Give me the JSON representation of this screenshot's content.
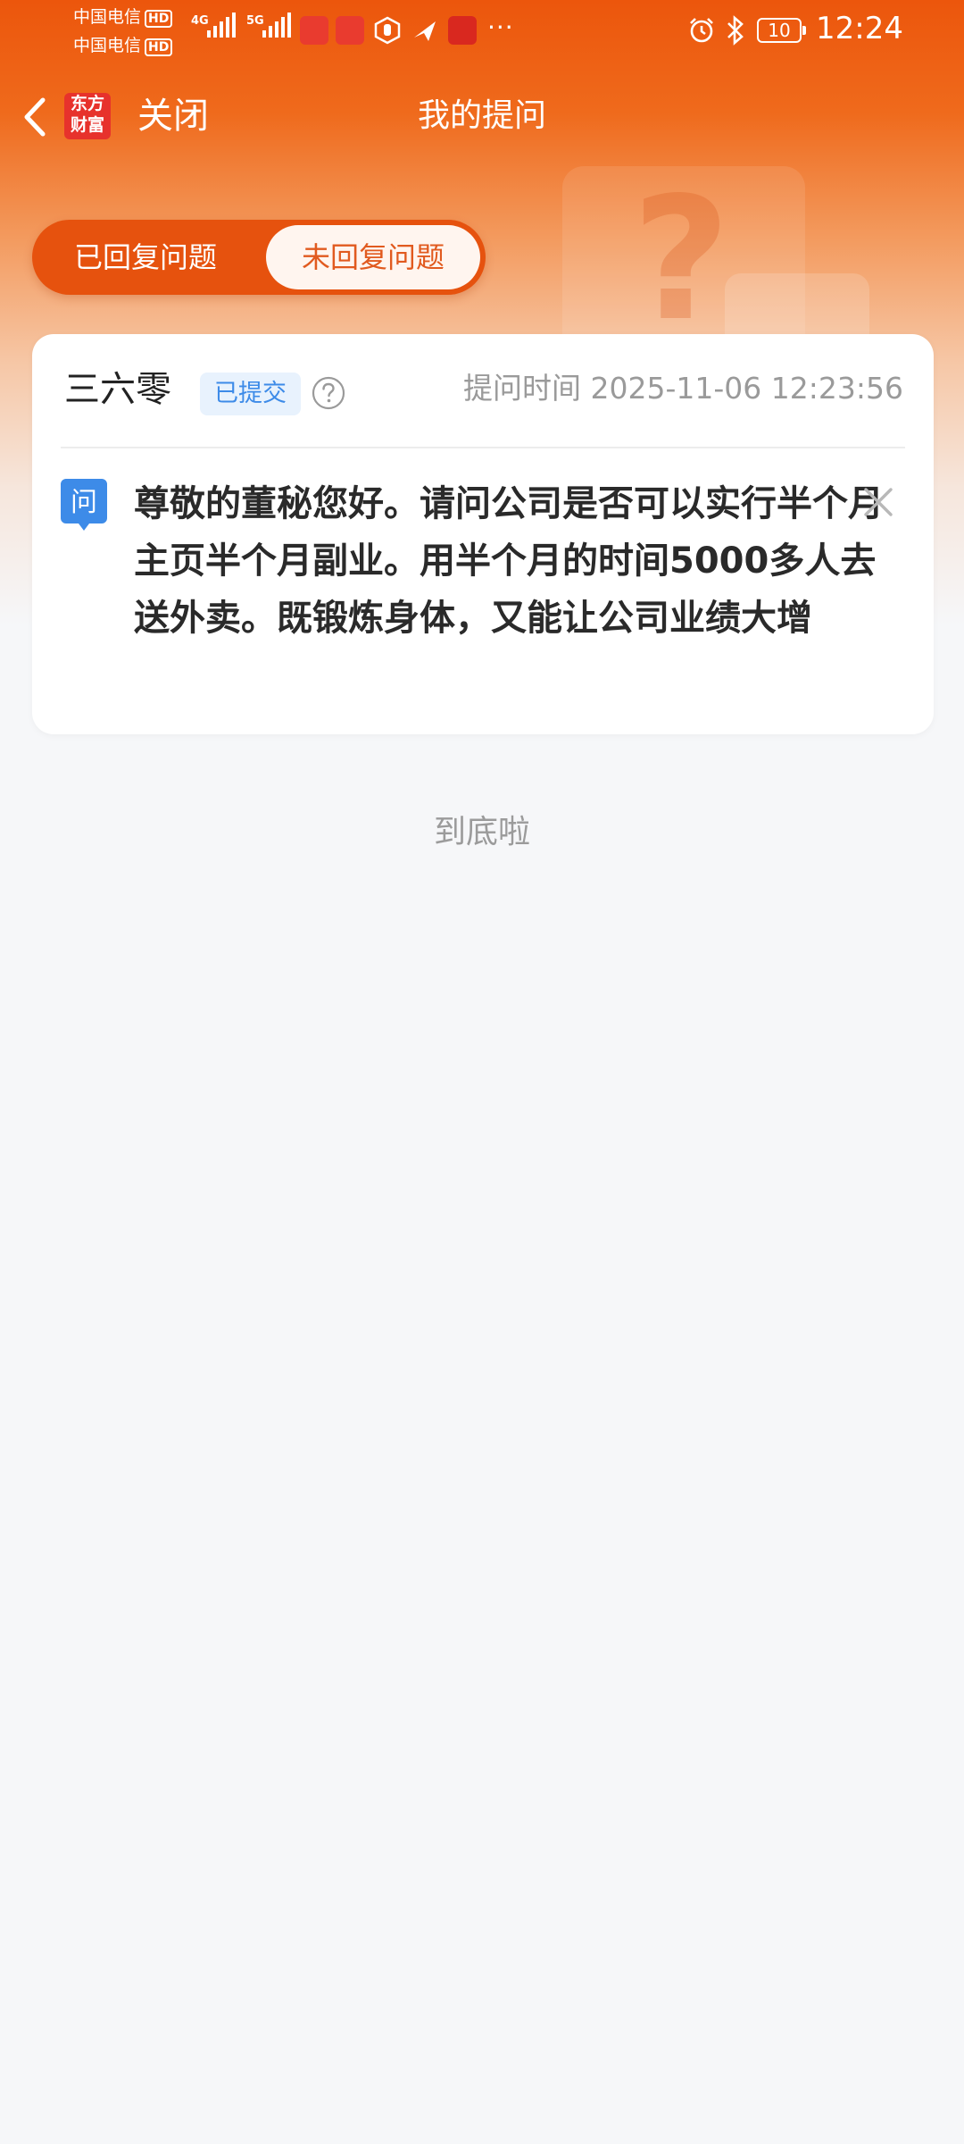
{
  "status_bar": {
    "carrier_1": "中国电信",
    "carrier_2": "中国电信",
    "hd": "HD",
    "net_1": "4G",
    "net_2": "5G",
    "battery": "10",
    "time": "12:24",
    "more": "···"
  },
  "nav": {
    "logo_text": "东方财富",
    "close_label": "关闭",
    "title": "我的提问"
  },
  "tabs": {
    "replied": "已回复问题",
    "unreplied": "未回复问题",
    "active": "unreplied"
  },
  "question_card": {
    "user": "三六零",
    "status": "已提交",
    "time_label": "提问时间 2025-11-06 12:23:56",
    "q_icon_label": "问",
    "content": "尊敬的董秘您好。请问公司是否可以实行半个月主页半个月副业。用半个月的时间5000多人去送外卖。既锻炼身体，又能让公司业绩大增"
  },
  "footer": {
    "end_text": "到底啦"
  },
  "colors": {
    "brand_orange": "#ec560c",
    "badge_blue": "#3d8be8",
    "badge_bg": "#e8f2fd",
    "page_bg": "#f6f7f9"
  }
}
